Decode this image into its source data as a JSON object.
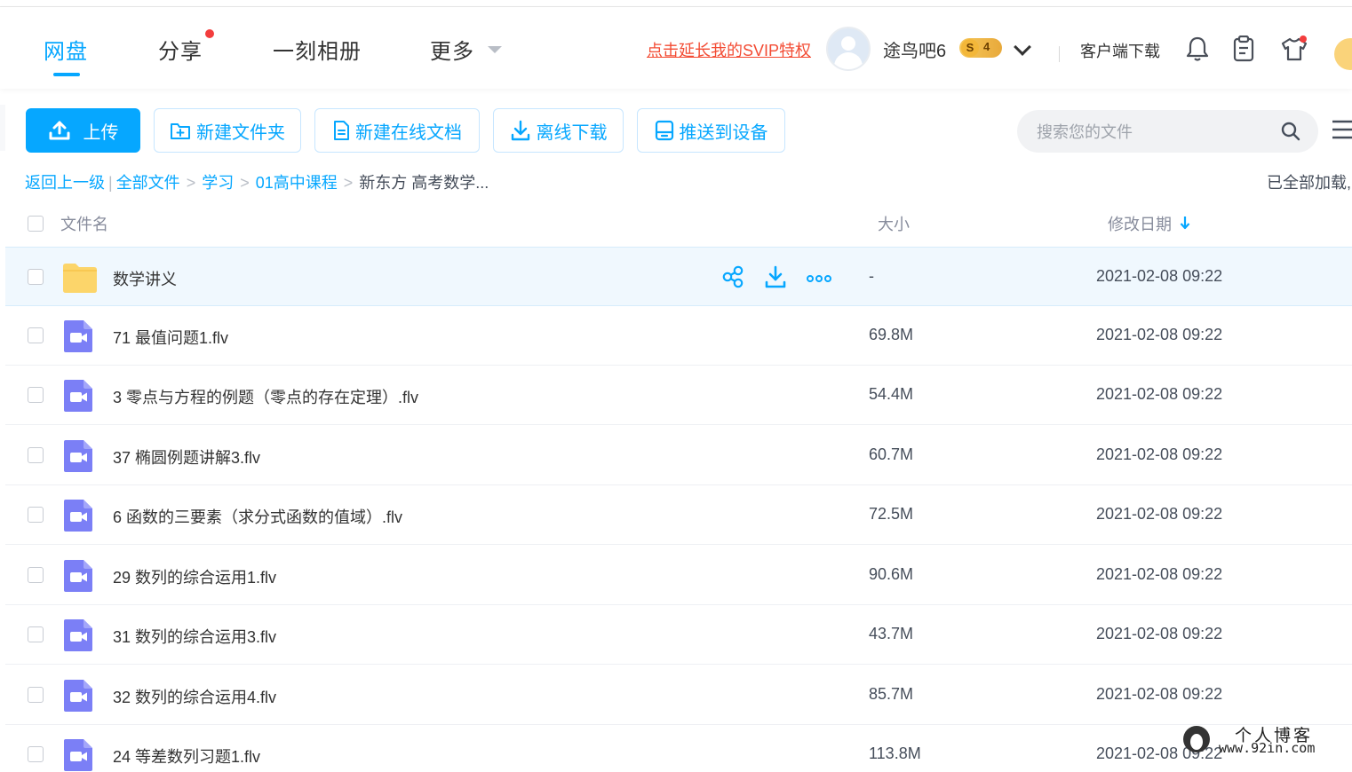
{
  "nav": {
    "tabs": [
      "网盘",
      "分享",
      "一刻相册",
      "更多"
    ],
    "svip_link": "点击延长我的SVIP特权",
    "username": "途鸟吧6",
    "svip_level_symbol": "S",
    "svip_level": "4",
    "client_download": "客户端下载",
    "icons": [
      "bell-icon",
      "clipboard-icon",
      "tshirt-icon"
    ]
  },
  "toolbar": {
    "upload": "上传",
    "new_folder": "新建文件夹",
    "new_doc": "新建在线文档",
    "offline_download": "离线下载",
    "push_device": "推送到设备",
    "search_placeholder": "搜索您的文件"
  },
  "breadcrumb": {
    "back": "返回上一级",
    "items": [
      "全部文件",
      "学习",
      "01高中课程"
    ],
    "current": "新东方 高考数学...",
    "loaded_status": "已全部加载,"
  },
  "table": {
    "headers": {
      "name": "文件名",
      "size": "大小",
      "date": "修改日期"
    },
    "rows": [
      {
        "name": "数学讲义",
        "size": "-",
        "date": "2021-02-08 09:22",
        "type": "folder"
      },
      {
        "name": "71 最值问题1.flv",
        "size": "69.8M",
        "date": "2021-02-08 09:22",
        "type": "video"
      },
      {
        "name": "3 零点与方程的例题（零点的存在定理）.flv",
        "size": "54.4M",
        "date": "2021-02-08 09:22",
        "type": "video"
      },
      {
        "name": "37 椭圆例题讲解3.flv",
        "size": "60.7M",
        "date": "2021-02-08 09:22",
        "type": "video"
      },
      {
        "name": "6 函数的三要素（求分式函数的值域）.flv",
        "size": "72.5M",
        "date": "2021-02-08 09:22",
        "type": "video"
      },
      {
        "name": "29 数列的综合运用1.flv",
        "size": "90.6M",
        "date": "2021-02-08 09:22",
        "type": "video"
      },
      {
        "name": "31 数列的综合运用3.flv",
        "size": "43.7M",
        "date": "2021-02-08 09:22",
        "type": "video"
      },
      {
        "name": "32 数列的综合运用4.flv",
        "size": "85.7M",
        "date": "2021-02-08 09:22",
        "type": "video"
      },
      {
        "name": "24 等差数列习题1.flv",
        "size": "113.8M",
        "date": "2021-02-08 09:22",
        "type": "video"
      }
    ]
  },
  "watermark": {
    "line1": "个人博客",
    "line2": "www.92in.com"
  },
  "colors": {
    "accent": "#06a7ff",
    "svip_link": "#f34b33",
    "video_icon": "#7b7ff6",
    "folder": "#fcd56a"
  }
}
